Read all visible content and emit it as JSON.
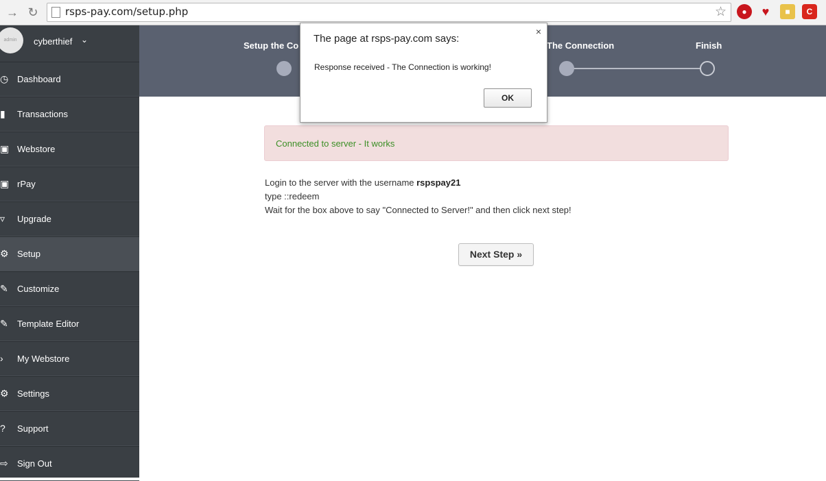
{
  "browser": {
    "url": "rsps-pay.com/setup.php"
  },
  "sidebar": {
    "username": "cyberthief",
    "avatar_text": "admin",
    "items": [
      {
        "label": "Dashboard",
        "icon": "dashboard-icon"
      },
      {
        "label": "Transactions",
        "icon": "bar-chart-icon"
      },
      {
        "label": "Webstore",
        "icon": "cart-icon"
      },
      {
        "label": "rPay",
        "icon": "cart-icon"
      },
      {
        "label": "Upgrade",
        "icon": "flask-icon"
      },
      {
        "label": "Setup",
        "icon": "gear-icon",
        "active": true
      },
      {
        "label": "Customize",
        "icon": "pencil-icon"
      },
      {
        "label": "Template Editor",
        "icon": "edit-icon"
      },
      {
        "label": "My Webstore",
        "icon": "arrow-icon"
      },
      {
        "label": "Settings",
        "icon": "cog-icon"
      },
      {
        "label": "Support",
        "icon": "question-icon"
      },
      {
        "label": "Sign Out",
        "icon": "sign-out-icon"
      }
    ]
  },
  "wizard": {
    "steps": [
      {
        "label": "Setup the Co",
        "state": "complete"
      },
      {
        "label": "The Connection",
        "state": "complete"
      },
      {
        "label": "Finish",
        "state": "pending"
      }
    ]
  },
  "alert": {
    "text": "Connected to server - It works"
  },
  "instructions": {
    "line1_prefix": "Login to the server with the username ",
    "username": "rspspay21",
    "line2": "type ::redeem",
    "line3": "Wait for the box above to say \"Connected to Server!\" and then click next step!"
  },
  "next_button": {
    "label": "Next Step »"
  },
  "dialog": {
    "title": "The page at rsps-pay.com says:",
    "message": "Response received - The Connection is working!",
    "ok_label": "OK",
    "close_glyph": "×"
  },
  "colors": {
    "sidebar_bg": "#3a3f44",
    "wizard_bg": "#5a6170",
    "alert_bg": "#f2dede",
    "alert_text": "#3c8f26"
  }
}
